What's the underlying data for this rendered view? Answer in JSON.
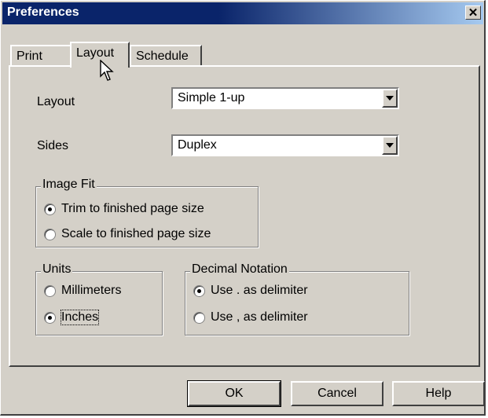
{
  "window": {
    "title": "Preferences",
    "close_glyph": "✕"
  },
  "tabs": [
    {
      "label": "Print",
      "active": false
    },
    {
      "label": "Layout",
      "active": true
    },
    {
      "label": "Schedule",
      "active": false
    }
  ],
  "layout_field": {
    "label": "Layout",
    "value": "Simple 1-up"
  },
  "sides_field": {
    "label": "Sides",
    "value": "Duplex"
  },
  "image_fit": {
    "legend": "Image Fit",
    "options": [
      {
        "label": "Trim to finished page size",
        "checked": true
      },
      {
        "label": "Scale to finished page size",
        "checked": false
      }
    ]
  },
  "units": {
    "legend": "Units",
    "options": [
      {
        "label": "Millimeters",
        "checked": false
      },
      {
        "label": "Inches",
        "checked": true
      }
    ]
  },
  "decimal_notation": {
    "legend": "Decimal Notation",
    "options": [
      {
        "label": "Use . as delimiter",
        "checked": true
      },
      {
        "label": "Use , as delimiter",
        "checked": false
      }
    ]
  },
  "buttons": {
    "ok": "OK",
    "cancel": "Cancel",
    "help": "Help"
  },
  "icons": {
    "dropdown": "chevron-down-icon",
    "cursor": "mouse-pointer-icon"
  }
}
